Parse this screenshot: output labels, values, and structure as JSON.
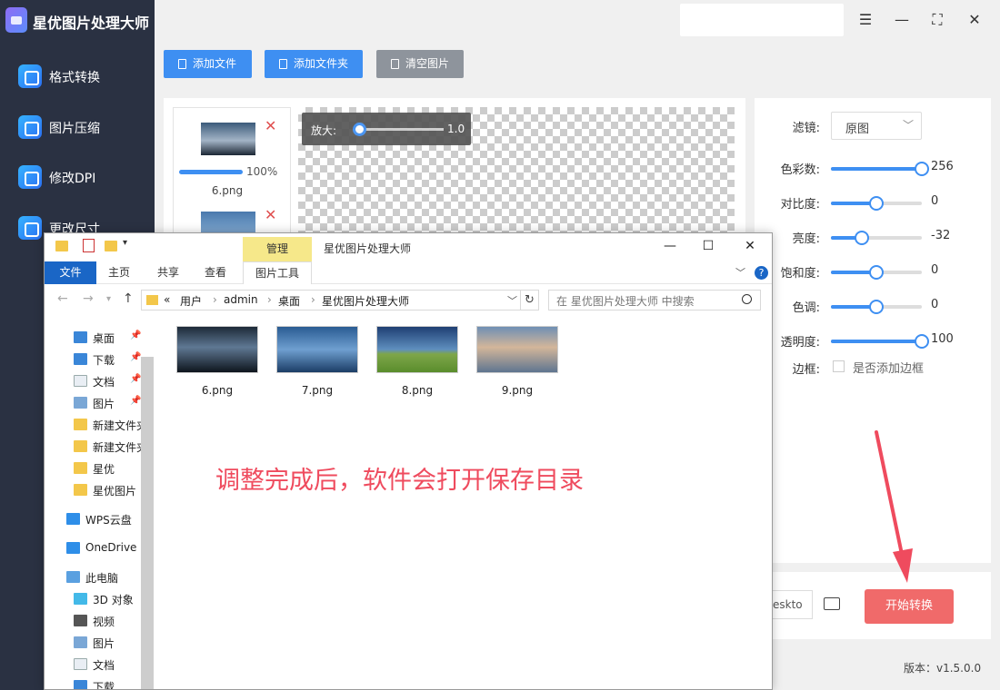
{
  "app": {
    "title": "星优图片处理大师",
    "version": "版本：v1.5.0.0"
  },
  "sidebar": {
    "items": [
      {
        "label": "格式转换"
      },
      {
        "label": "图片压缩"
      },
      {
        "label": "修改DPI"
      },
      {
        "label": "更改尺寸"
      }
    ]
  },
  "toolbar": {
    "add_file": "添加文件",
    "add_folder": "添加文件夹",
    "clear": "清空图片"
  },
  "file_list": {
    "items": [
      {
        "name": "6.png",
        "progress_pct": "100%",
        "progress": 1.0
      }
    ]
  },
  "preview": {
    "zoom_label": "放大:",
    "zoom_value": "1.0"
  },
  "settings": {
    "filter_label": "滤镜:",
    "filter_value": "原图",
    "sliders": [
      {
        "label": "色彩数:",
        "value": "256",
        "fraction": 1.0
      },
      {
        "label": "对比度:",
        "value": "0",
        "fraction": 0.5
      },
      {
        "label": "亮度:",
        "value": "-32",
        "fraction": 0.34
      },
      {
        "label": "饱和度:",
        "value": "0",
        "fraction": 0.5
      },
      {
        "label": "色调:",
        "value": "0",
        "fraction": 0.5
      },
      {
        "label": "透明度:",
        "value": "100",
        "fraction": 1.0
      }
    ],
    "border_label": "边框:",
    "border_checkbox": "是否添加边框"
  },
  "output": {
    "path_value": "eskto",
    "start_button": "开始转换"
  },
  "explorer": {
    "manage_tab": "管理",
    "title": "星优图片处理大师",
    "ribbon_tabs": [
      "文件",
      "主页",
      "共享",
      "查看"
    ],
    "picture_tools": "图片工具",
    "breadcrumb": [
      "«",
      "用户",
      "admin",
      "桌面",
      "星优图片处理大师"
    ],
    "search_placeholder": "在 星优图片处理大师 中搜索",
    "nav_items": [
      {
        "label": "桌面",
        "icon": "desktop-icon",
        "color": "#3a86d8",
        "pinned": true
      },
      {
        "label": "下载",
        "icon": "download-icon",
        "color": "#3a86d8",
        "pinned": true
      },
      {
        "label": "文档",
        "icon": "document-icon",
        "color": "#e9eef4",
        "pinned": true
      },
      {
        "label": "图片",
        "icon": "pictures-icon",
        "color": "#7aa7d6",
        "pinned": true
      },
      {
        "label": "新建文件夹",
        "icon": "folder-icon",
        "color": "#f3c74a",
        "pinned": false
      },
      {
        "label": "新建文件夹",
        "icon": "folder-icon",
        "color": "#f3c74a",
        "pinned": false
      },
      {
        "label": "星优",
        "icon": "folder-icon",
        "color": "#f3c74a",
        "pinned": false
      },
      {
        "label": "星优图片",
        "icon": "folder-icon",
        "color": "#f3c74a",
        "pinned": false
      },
      {
        "label": "WPS云盘",
        "icon": "cloud-icon",
        "color": "#2e8ee8",
        "pinned": false
      },
      {
        "label": "OneDrive",
        "icon": "onedrive-icon",
        "color": "#2e8ee8",
        "pinned": false
      },
      {
        "label": "此电脑",
        "icon": "computer-icon",
        "color": "#5aa0e0",
        "pinned": false
      },
      {
        "label": "3D 对象",
        "icon": "3d-objects-icon",
        "color": "#43b9e8",
        "pinned": false
      },
      {
        "label": "视频",
        "icon": "video-icon",
        "color": "#555555",
        "pinned": false
      },
      {
        "label": "图片",
        "icon": "pictures-icon",
        "color": "#7aa7d6",
        "pinned": false
      },
      {
        "label": "文档",
        "icon": "document-icon",
        "color": "#e9eef4",
        "pinned": false
      },
      {
        "label": "下载",
        "icon": "download-icon",
        "color": "#3a86d8",
        "pinned": false
      }
    ],
    "files": [
      {
        "name": "6.png"
      },
      {
        "name": "7.png"
      },
      {
        "name": "8.png"
      },
      {
        "name": "9.png"
      }
    ]
  },
  "overlay_note": "调整完成后，软件会打开保存目录",
  "colors": {
    "accent": "#3e8ff2",
    "start_button": "#f06a6a",
    "annotation": "#ef4b5e",
    "sidebar_bg": "#2a3142"
  }
}
